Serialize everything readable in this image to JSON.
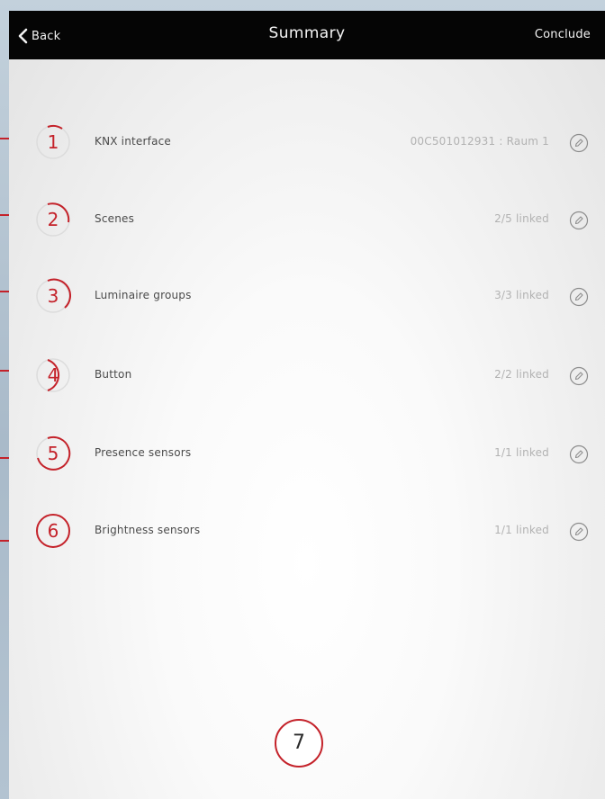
{
  "nav": {
    "back_label": "Back",
    "title": "Summary",
    "conclude_label": "Conclude"
  },
  "accent_color": "#c4222a",
  "rows": [
    {
      "step": "1",
      "label": "KNX interface",
      "status": "00C501012931 : Raum 1",
      "edit_icon": "pencil-icon"
    },
    {
      "step": "2",
      "label": "Scenes",
      "status": "2/5 linked",
      "edit_icon": "pencil-icon"
    },
    {
      "step": "3",
      "label": "Luminaire groups",
      "status": "3/3 linked",
      "edit_icon": "pencil-icon"
    },
    {
      "step": "4",
      "label": "Button",
      "status": "2/2 linked",
      "edit_icon": "pencil-icon"
    },
    {
      "step": "5",
      "label": "Presence sensors",
      "status": "1/1 linked",
      "edit_icon": "pencil-icon"
    },
    {
      "step": "6",
      "label": "Brightness sensors",
      "status": "1/1 linked",
      "edit_icon": "pencil-icon"
    }
  ],
  "final_step": "7"
}
